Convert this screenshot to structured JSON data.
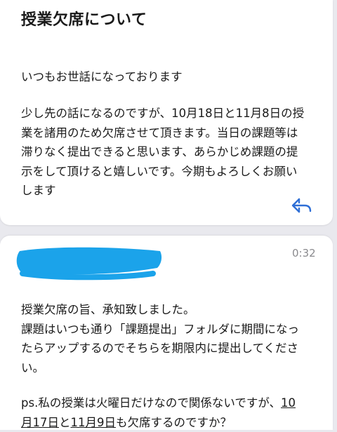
{
  "message1": {
    "subject": "授業欠席について",
    "greeting": "いつもお世話になっております",
    "body_lines": [
      "少し先の話になるのですが、10月18日と11月8日の授",
      "業を諸用のため欠席させて頂きます。当日の課題等は",
      "滞りなく提出できると思います、あらかじめ課題の提",
      "示をして頂けると嬉しいです。今期もよろしくお願い",
      "します"
    ],
    "reply_icon": "reply-arrow-icon"
  },
  "message2": {
    "sender_redaction_color": "#1ba3ea",
    "time": "0:32",
    "paragraph1_lines": [
      "授業欠席の旨、承知致しました。",
      "課題はいつも通り「課題提出」フォルダに期間になっ",
      "たらアップするのでそちらを期限内に提出してくださ",
      "い。"
    ],
    "ps_line1_prefix": "ps.私の授業は火曜日だけなので関係ないですが、",
    "ps_line1_link": "10",
    "ps_line2_link": "月17日",
    "ps_line2_mid": "と",
    "ps_line2_link2": "11月9日",
    "ps_line2_suffix": "も欠席するのですか？"
  },
  "colors": {
    "background": "#e9e9ee",
    "card": "#ffffff",
    "text": "#1a1a1a",
    "accent_blue": "#2f6fd6",
    "time_gray": "#8a8a8e"
  }
}
